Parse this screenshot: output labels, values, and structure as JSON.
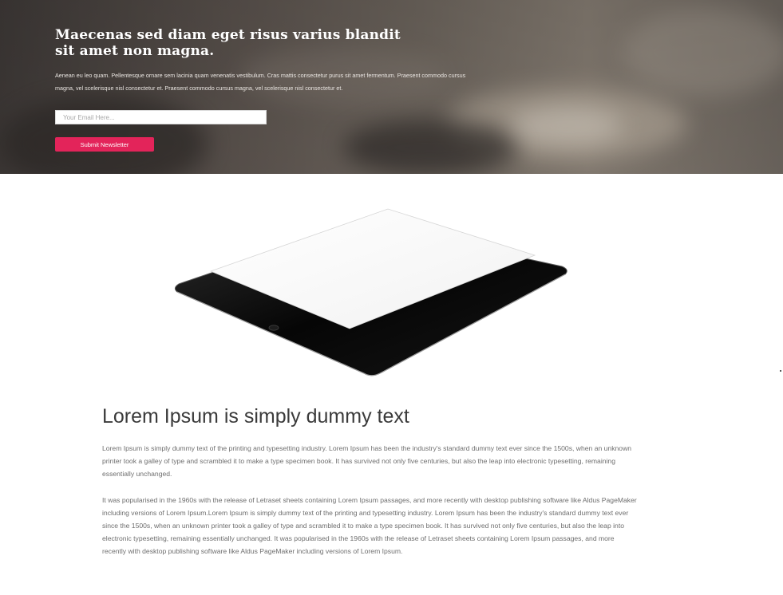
{
  "hero": {
    "title": "Maecenas sed diam eget risus varius blandit sit amet non magna.",
    "description": "Aenean eu leo quam. Pellentesque ornare sem lacinia quam venenatis vestibulum. Cras mattis consectetur purus sit amet fermentum. Praesent commodo cursus magna, vel scelerisque nisl consectetur et. Praesent commodo cursus magna, vel scelerisque nisl consectetur et.",
    "email_placeholder": "Your Email Here...",
    "submit_label": "Submit Newsletter"
  },
  "article": {
    "title": "Lorem Ipsum is simply dummy text",
    "paragraph1": "Lorem Ipsum is simply dummy text of the printing and typesetting industry. Lorem Ipsum has been the industry's standard dummy text ever since the 1500s, when an unknown printer took a galley of type and scrambled it to make a type specimen book. It has survived not only five centuries, but also the leap into electronic typesetting, remaining essentially unchanged.",
    "paragraph2": "It was popularised in the 1960s with the release of Letraset sheets containing Lorem Ipsum passages, and more recently with desktop publishing software like Aldus PageMaker including versions of Lorem Ipsum.Lorem Ipsum is simply dummy text of the printing and typesetting industry. Lorem Ipsum has been the industry's standard dummy text ever since the 1500s, when an unknown printer took a galley of type and scrambled it to make a type specimen book. It has survived not only five centuries, but also the leap into electronic typesetting, remaining essentially unchanged. It was popularised in the 1960s with the release of Letraset sheets containing Lorem Ipsum passages, and more recently with desktop publishing software like Aldus PageMaker including versions of Lorem Ipsum."
  },
  "colors": {
    "accent": "#e3245a",
    "hero_overlay": "#5a524d"
  },
  "icons": {
    "device": "tablet-icon"
  }
}
